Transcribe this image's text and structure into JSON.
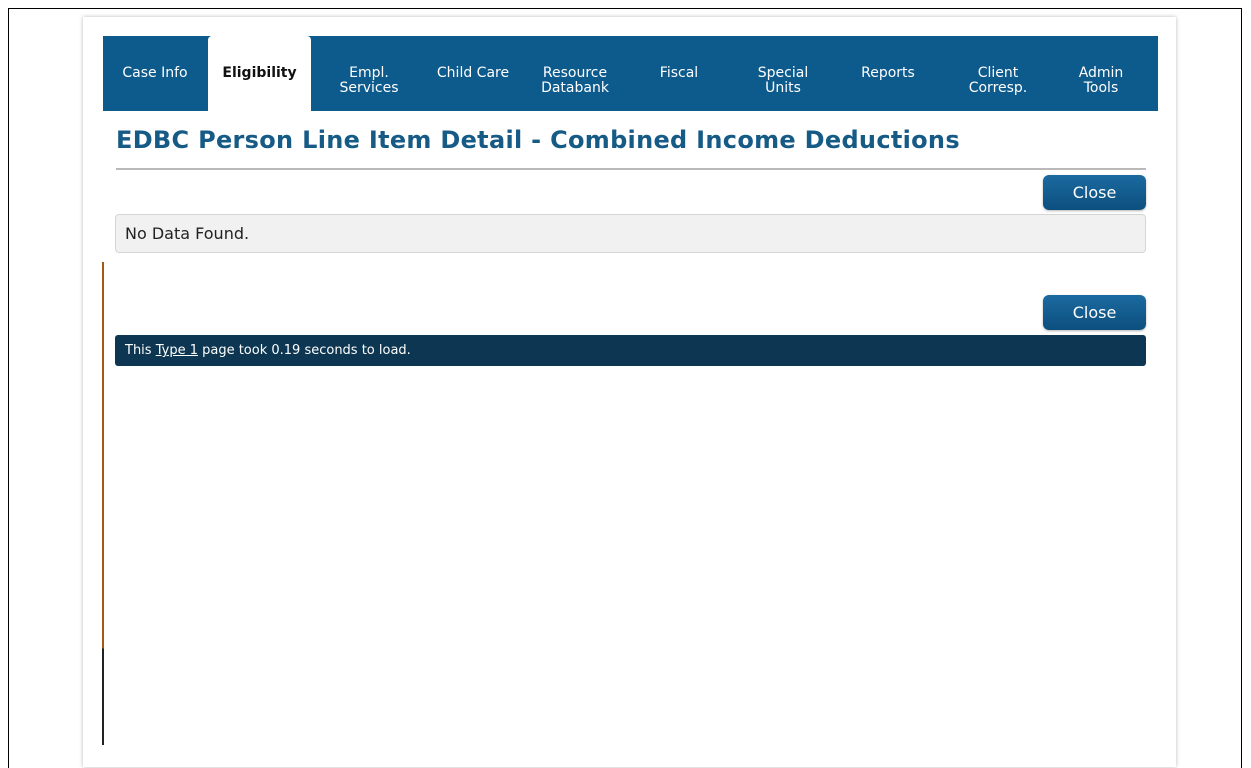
{
  "nav": {
    "tabs": [
      {
        "label": "Case Info"
      },
      {
        "label": "Eligibility"
      },
      {
        "label": "Empl.\nServices"
      },
      {
        "label": "Child Care"
      },
      {
        "label": "Resource\nDatabank"
      },
      {
        "label": "Fiscal"
      },
      {
        "label": "Special\nUnits"
      },
      {
        "label": "Reports"
      },
      {
        "label": "Client\nCorresp."
      },
      {
        "label": "Admin\nTools"
      }
    ],
    "active": "Eligibility"
  },
  "page": {
    "title": "EDBC Person Line Item Detail - Combined Income Deductions",
    "close_label": "Close",
    "no_data_message": "No Data Found."
  },
  "status_bar": {
    "prefix": "This ",
    "link": "Type 1",
    "suffix": " page took 0.19 seconds to load."
  },
  "colors": {
    "nav_background": "#0d5a8c",
    "title_text": "#165a86",
    "status_background": "#0c3651"
  }
}
